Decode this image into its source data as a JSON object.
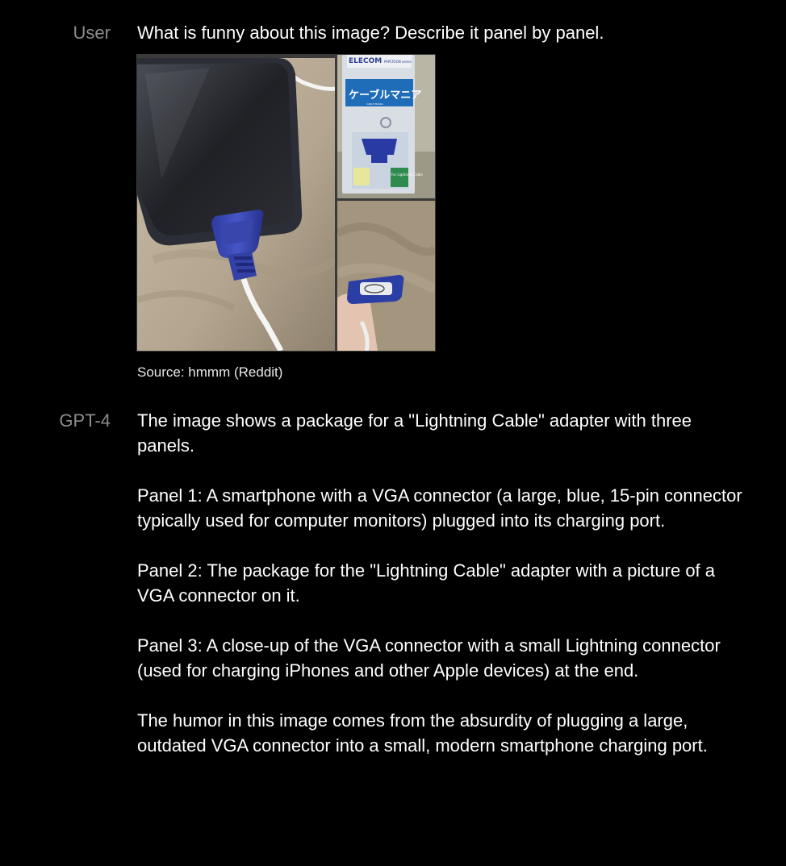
{
  "conversation": {
    "user": {
      "speaker": "User",
      "text": "What is funny about this image? Describe it panel by panel.",
      "image_caption": "Source: hmmm (Reddit)",
      "image_text": {
        "brand": "ELECOM",
        "series": "PAPLTOON series",
        "title": "ケーブルマニア",
        "subtitle": "CABLE MANIA",
        "for_text": "For Lightning Cable"
      }
    },
    "assistant": {
      "speaker": "GPT-4",
      "paragraphs": [
        "The image shows a package for a \"Lightning Cable\" adapter with three panels.",
        "Panel 1: A smartphone with a VGA connector (a large, blue, 15-pin connector typically used for computer monitors) plugged into its charging port.",
        "Panel 2: The package for the \"Lightning Cable\" adapter with a picture of a VGA connector on it.",
        "Panel 3: A close-up of the VGA connector with a small Lightning connector (used for charging iPhones and other Apple devices) at the end.",
        "The humor in this image comes from the absurdity of plugging a large, outdated VGA connector into a small, modern smartphone charging port."
      ]
    }
  }
}
